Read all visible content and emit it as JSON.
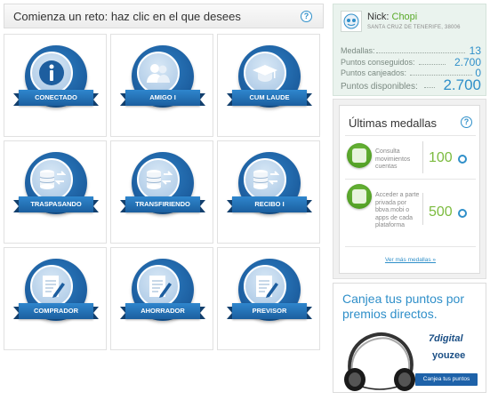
{
  "challenges": {
    "title": "Comienza un reto: haz clic en el que desees",
    "help": "?",
    "tiles": [
      {
        "label": "CONECTADO",
        "icon": "info-icon"
      },
      {
        "label": "AMIGO I",
        "icon": "people-icon"
      },
      {
        "label": "CUM LAUDE",
        "icon": "graduation-cap-icon"
      },
      {
        "label": "TRASPASANDO",
        "icon": "coins-transfer-icon"
      },
      {
        "label": "TRANSFIRIENDO",
        "icon": "coins-transfer-icon"
      },
      {
        "label": "RECIBO I",
        "icon": "coins-transfer-icon"
      },
      {
        "label": "COMPRADOR",
        "icon": "document-pen-icon"
      },
      {
        "label": "AHORRADOR",
        "icon": "document-pen-icon"
      },
      {
        "label": "PREVISOR",
        "icon": "document-pen-icon"
      }
    ]
  },
  "user": {
    "nick_label": "Nick: ",
    "nick": "Chopi",
    "location": "SANTA CRUZ DE TENERIFE, 38006",
    "stats": {
      "medallas_label": "Medallas:",
      "medallas": "13",
      "conseguidos_label": "Puntos conseguidos:",
      "conseguidos": "2.700",
      "canjeados_label": "Puntos canjeados:",
      "canjeados": "0",
      "disponibles_label": "Puntos disponibles:",
      "disponibles": "2.700"
    },
    "colors": {
      "accent": "#2f8fc9",
      "nick": "#5aaa2a"
    }
  },
  "medals": {
    "title": "Últimas medallas",
    "help": "?",
    "items": [
      {
        "text": "Consulta movimientos cuentas",
        "points": "100"
      },
      {
        "text": "Acceder a parte privada por bbva.mobi o apps de cada plataforma",
        "points": "500"
      }
    ],
    "more_link": "Ver más medallas »"
  },
  "promo": {
    "title": "Canjea tus puntos por premios directos.",
    "brand1": "7digital",
    "brand2": "youzee",
    "button": "Canjea tus puntos"
  }
}
